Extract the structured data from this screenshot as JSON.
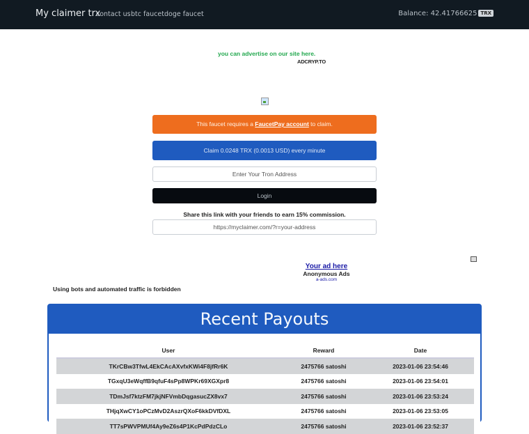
{
  "nav": {
    "brand": "My claimer trx",
    "links": [
      "contact us",
      "btc faucet",
      "doge faucet"
    ],
    "balance_label": "Balance: 42.41766625",
    "balance_currency": "TRX"
  },
  "ad": {
    "text": "you can advertise on our site here.",
    "logo": "ADCRYP.TO"
  },
  "faucet": {
    "alert_prefix": "This faucet requires a",
    "alert_link": "FaucetPay account",
    "alert_suffix": "to claim.",
    "claim_text": "Claim 0.0248 TRX (0.0013 USD) every minute",
    "address_placeholder": "Enter Your Tron Address",
    "login_label": "Login",
    "share_text": "Share this link with your friends to earn 15% commission.",
    "referral_link": "https://myclaimer.com/?r=your-address"
  },
  "aads": {
    "link": "Your ad here",
    "name": "Anonymous Ads",
    "domain": "a-ads.com"
  },
  "warning": "Using bots and automated traffic is forbidden",
  "payouts": {
    "title": "Recent Payouts",
    "columns": [
      "User",
      "Reward",
      "Date"
    ],
    "rows": [
      {
        "user": "TKrCBw3TfwL4EkCAcAXvfxKWi4F8jfRr6K",
        "reward": "2475766 satoshi",
        "date": "2023-01-06 23:54:46"
      },
      {
        "user": "TGxqU3eWqffB9qfuF4sPp8WPKr69XGXpr8",
        "reward": "2475766 satoshi",
        "date": "2023-01-06 23:54:01"
      },
      {
        "user": "TDmJsf7ktzFM7jkjNFVmbDqgasucZX8vx7",
        "reward": "2475766 satoshi",
        "date": "2023-01-06 23:53:24"
      },
      {
        "user": "THjqXwCY1oPCzMvD2AszrQXoF6kkDVfDXL",
        "reward": "2475766 satoshi",
        "date": "2023-01-06 23:53:05"
      },
      {
        "user": "TT7sPWVPMUf4Ay9eZ6s4P1KcPdPdzCLo",
        "reward": "2475766 satoshi",
        "date": "2023-01-06 23:52:37"
      }
    ]
  },
  "colors": {
    "navbar": "#111a22",
    "alert": "#ee6d1e",
    "primary": "#1f5bbf",
    "ad_green": "#23a84f"
  }
}
